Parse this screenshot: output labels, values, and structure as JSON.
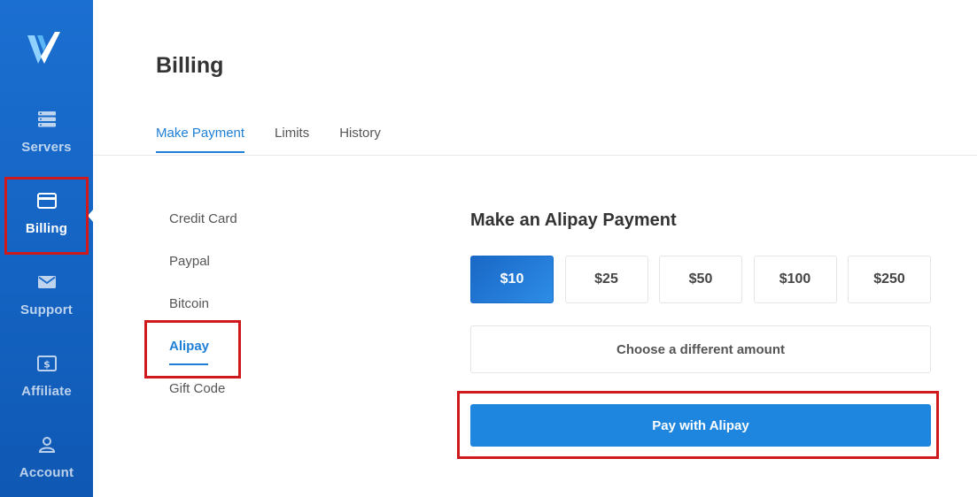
{
  "sidebar": {
    "logo_icon": "vultr-v-logo",
    "items": [
      {
        "label": "Servers",
        "icon": "server-stack-icon"
      },
      {
        "label": "Billing",
        "icon": "credit-card-icon"
      },
      {
        "label": "Support",
        "icon": "envelope-icon"
      },
      {
        "label": "Affiliate",
        "icon": "dollar-bill-icon"
      },
      {
        "label": "Account",
        "icon": "user-icon"
      }
    ],
    "active_item": "Billing"
  },
  "page": {
    "title": "Billing"
  },
  "tabs": [
    {
      "label": "Make Payment",
      "active": true
    },
    {
      "label": "Limits",
      "active": false
    },
    {
      "label": "History",
      "active": false
    }
  ],
  "payment_methods": [
    {
      "label": "Credit Card",
      "active": false
    },
    {
      "label": "Paypal",
      "active": false
    },
    {
      "label": "Bitcoin",
      "active": false
    },
    {
      "label": "Alipay",
      "active": true
    },
    {
      "label": "Gift Code",
      "active": false
    }
  ],
  "payment": {
    "title": "Make an Alipay Payment",
    "amounts": [
      "$10",
      "$25",
      "$50",
      "$100",
      "$250"
    ],
    "selected_amount": "$10",
    "custom_amount_label": "Choose a different amount",
    "submit_label": "Pay with Alipay"
  },
  "colors": {
    "sidebar_blue": "#1463c2",
    "accent_blue": "#1e7fd6",
    "button_blue": "#1f86e0",
    "highlight_red": "#d0191c"
  }
}
